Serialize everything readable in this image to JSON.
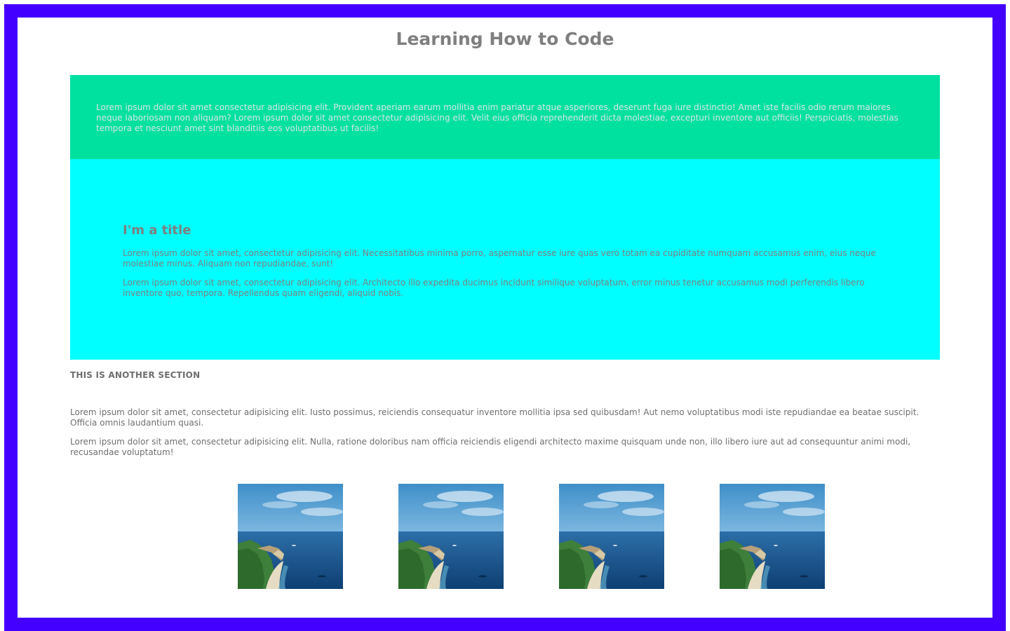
{
  "page": {
    "title": "Learning How to Code",
    "frame_color": "#4400ff"
  },
  "intro_section": {
    "color": "#00e09f",
    "text": "Lorem ipsum dolor sit amet consectetur adipisicing elit. Provident aperiam earum mollitia enim pariatur atque asperiores, deserunt fuga iure distinctio! Amet iste facilis odio rerum maiores neque laboriosam non aliquam? Lorem ipsum dolor sit amet consectetur adipisicing elit. Velit eius officia reprehenderit dicta molestiae, excepturi inventore aut officiis! Perspiciatis, molestias tempora et nesciunt amet sint blanditiis eos voluptatibus ut facilis!"
  },
  "title_section": {
    "color": "#00ffff",
    "heading": "I'm a title",
    "paragraphs": [
      "Lorem ipsum dolor sit amet, consectetur adipisicing elit. Necessitatibus minima porro, aspernatur esse iure quas vero totam ea cupiditate numquam accusamus enim, eius neque molestiae minus. Aliquam non repudiandae, sunt!",
      "Lorem ipsum dolor sit amet, consectetur adipisicing elit. Architecto illo expedita ducimus incidunt similique voluptatum, error minus tenetur accusamus modi perferendis libero inventore quo, tempora. Repellendus quam eligendi, aliquid nobis."
    ]
  },
  "another_section": {
    "heading": "THIS IS ANOTHER SECTION",
    "paragraphs": [
      "Lorem ipsum dolor sit amet, consectetur adipisicing elit. Iusto possimus, reiciendis consequatur inventore mollitia ipsa sed quibusdam! Aut nemo voluptatibus modi iste repudiandae ea beatae suscipit. Officia omnis laudantium quasi.",
      "Lorem ipsum dolor sit amet, consectetur adipisicing elit. Nulla, ratione doloribus nam officia reiciendis eligendi architecto maxime quisquam unde non, illo libero iure aut ad consequuntur animi modi, recusandae voluptatum!"
    ]
  },
  "gallery": {
    "images": [
      "coastline-photo",
      "coastline-photo",
      "coastline-photo",
      "coastline-photo"
    ]
  }
}
